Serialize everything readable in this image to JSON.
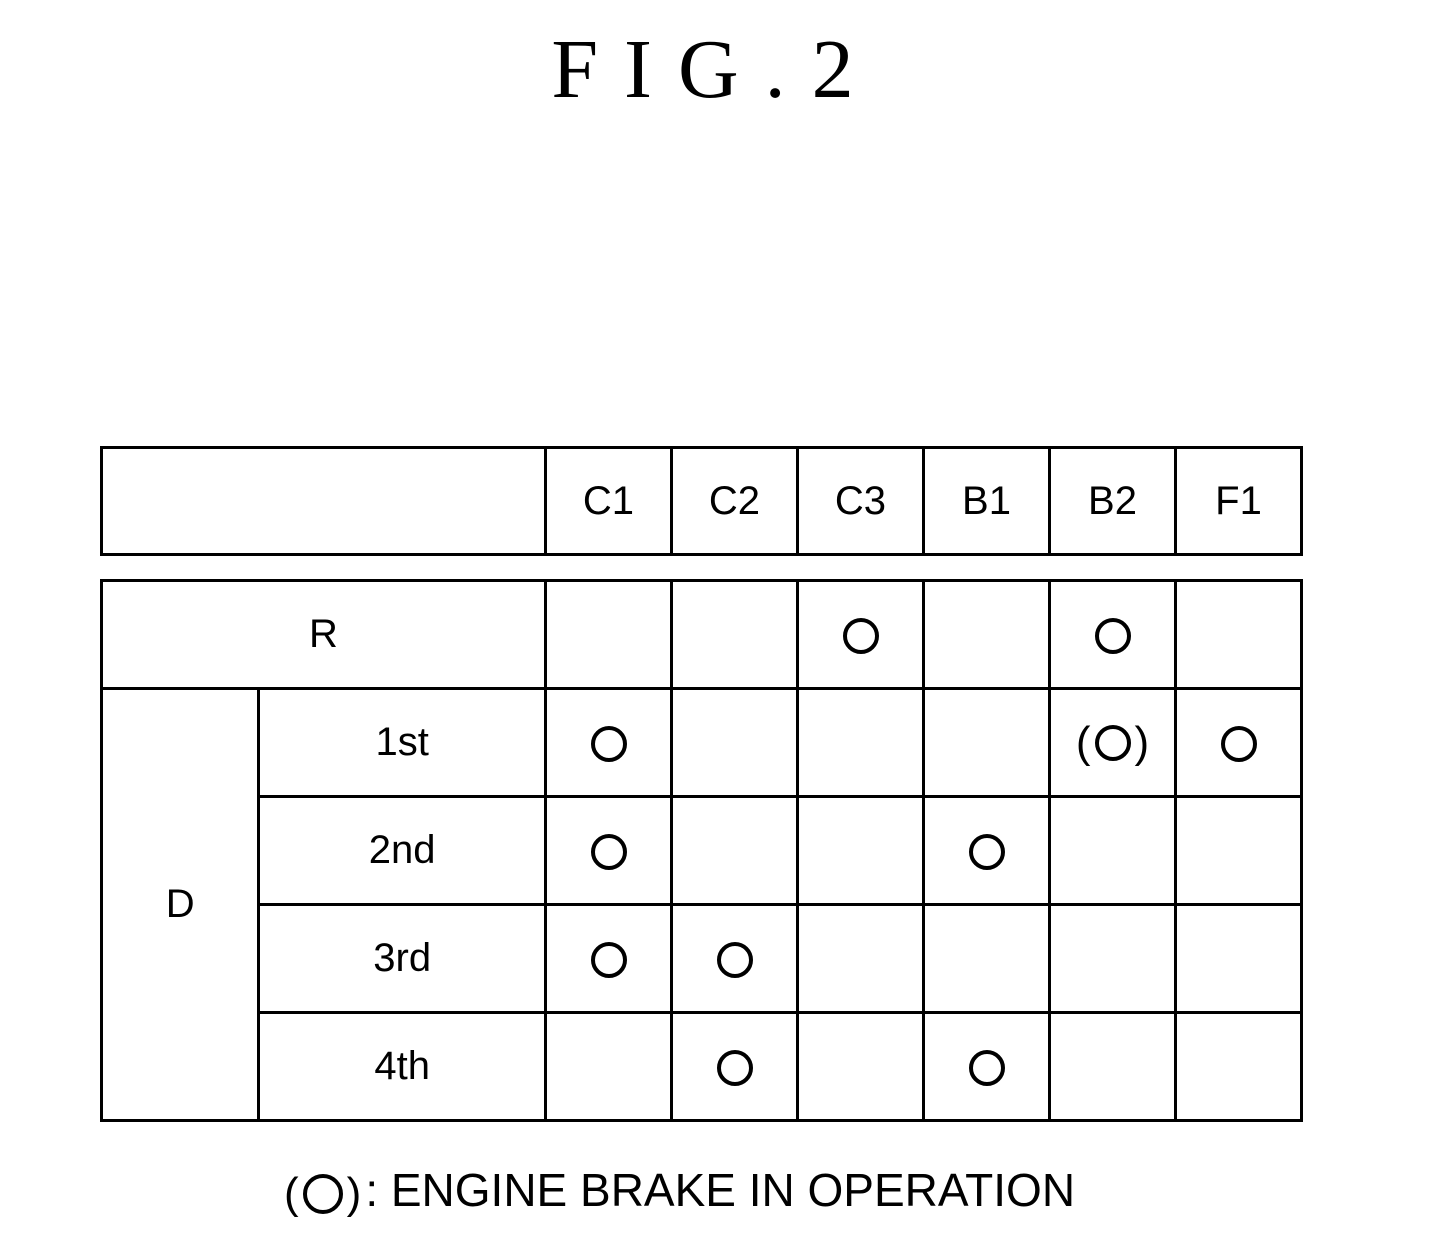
{
  "figure": {
    "title": "FIG.2"
  },
  "table": {
    "columns": [
      "C1",
      "C2",
      "C3",
      "B1",
      "B2",
      "F1"
    ],
    "mode_d_label": "D",
    "rows": [
      {
        "mode": "R",
        "gear": "",
        "cells": [
          "",
          "",
          "O",
          "",
          "O",
          ""
        ]
      },
      {
        "mode": "D",
        "gear": "1st",
        "cells": [
          "O",
          "",
          "",
          "",
          "(O)",
          "O"
        ]
      },
      {
        "mode": "D",
        "gear": "2nd",
        "cells": [
          "O",
          "",
          "",
          "O",
          "",
          ""
        ]
      },
      {
        "mode": "D",
        "gear": "3rd",
        "cells": [
          "O",
          "O",
          "",
          "",
          "",
          ""
        ]
      },
      {
        "mode": "D",
        "gear": "4th",
        "cells": [
          "",
          "O",
          "",
          "O",
          "",
          ""
        ]
      }
    ]
  },
  "legend": {
    "symbol": "(O)",
    "text": ": ENGINE BRAKE IN OPERATION"
  }
}
